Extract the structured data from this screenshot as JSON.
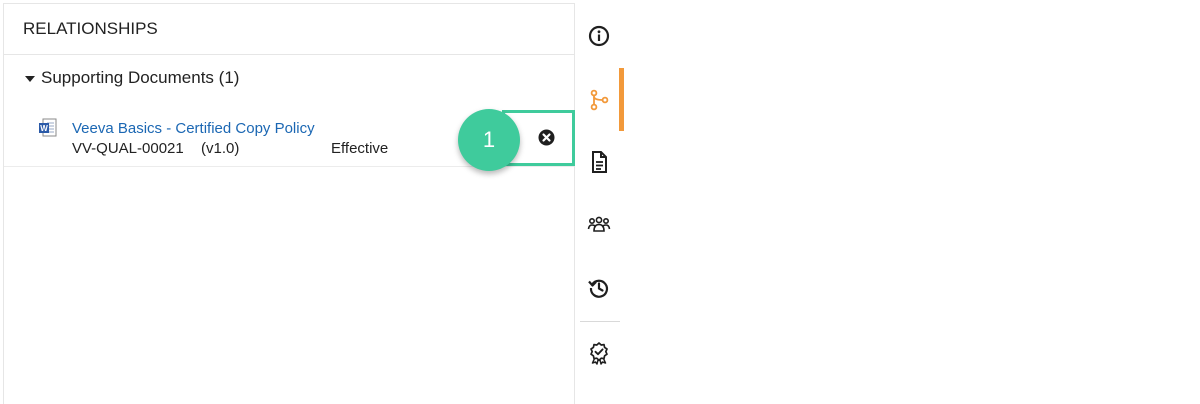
{
  "panel": {
    "title": "RELATIONSHIPS",
    "section": {
      "label": "Supporting Documents (1)"
    },
    "documents": [
      {
        "title": "Veeva Basics - Certified Copy Policy",
        "number": "VV-QUAL-00021",
        "version": "(v1.0)",
        "status": "Effective",
        "icon": "word-document-icon"
      }
    ]
  },
  "callout": {
    "step": "1",
    "accent": "#3fcb9c"
  },
  "rail": {
    "items": [
      {
        "icon": "info-icon",
        "active": false
      },
      {
        "icon": "relationships-icon",
        "active": true
      },
      {
        "icon": "document-icon",
        "active": false
      },
      {
        "icon": "users-icon",
        "active": false
      },
      {
        "icon": "history-icon",
        "active": false
      },
      {
        "icon": "certification-icon",
        "active": false
      }
    ],
    "active_color": "#f2993a"
  },
  "colors": {
    "link": "#1b67b3",
    "text": "#222222"
  }
}
